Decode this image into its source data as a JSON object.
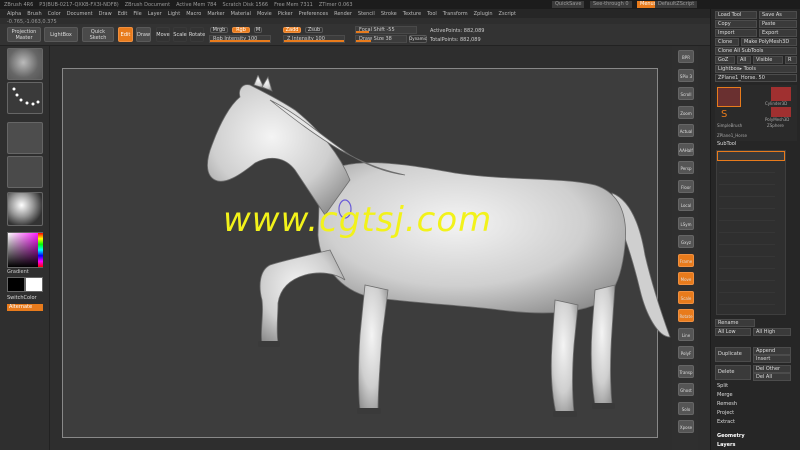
{
  "titlebar": {
    "items": [
      "ZBrush 4R6",
      "P3(BUB-0217-QXKB-FX3I-NDF8)",
      "ZBrush Document",
      "Active Mem 784",
      "Scratch Disk 1566",
      "Free Mem 7311",
      "ZTimer 0.063"
    ],
    "quicksave": "QuickSave",
    "seethrough": "See-through 0",
    "menus": "Menus",
    "script": "DefaultZScript"
  },
  "menubar": [
    "Alpha",
    "Brush",
    "Color",
    "Document",
    "Draw",
    "Edit",
    "File",
    "Layer",
    "Light",
    "Macro",
    "Marker",
    "Material",
    "Movie",
    "Picker",
    "Preferences",
    "Render",
    "Stencil",
    "Stroke",
    "Texture",
    "Tool",
    "Transform",
    "Zplugin",
    "Zscript"
  ],
  "coord": "-0.765,-1.063,0.375",
  "topshelf": {
    "projection_master": "Projection Master",
    "lightbox": "LightBox",
    "quick_sketch": "Quick Sketch",
    "edit": "Edit",
    "draw": "Draw",
    "move": "Move",
    "scale": "Scale",
    "rotate": "Rotate",
    "mrgb": "Mrgb",
    "rgb": "Rgb",
    "m": "M",
    "rgb_intensity": "Rgb Intensity 100",
    "zadd": "Zadd",
    "zsub": "Zsub",
    "z_intensity": "Z Intensity 100",
    "focal_shift": "Focal Shift -55",
    "draw_size": "Draw Size 38",
    "dynamic": "Dynamic",
    "active_points": "ActivePoints: 882,089",
    "total_points": "TotalPoints: 882,089"
  },
  "leftshelf": {
    "gradient": "Gradient",
    "switchcolor": "SwitchColor",
    "alternate": "Alternate"
  },
  "rightshelf": [
    "BPR",
    "SPix 3",
    "Scroll",
    "Zoom",
    "Actual",
    "AAHalf",
    "Persp",
    "Floor",
    "Local",
    "LSym",
    "Gxyz",
    "Frame",
    "Move",
    "Scale",
    "Rotate",
    "Line Fill",
    "PolyF",
    "Transp",
    "Ghost",
    "Solo",
    "Xpose"
  ],
  "tray": {
    "load_tool": "Load Tool",
    "save_as": "Save As",
    "copy": "Copy",
    "paste": "Paste",
    "import": "Import",
    "export": "Export",
    "clone": "Clone",
    "make_polymesh": "Make PolyMesh3D",
    "clone_all": "Clone All SubTools",
    "goz": "GoZ",
    "all": "All",
    "visible": "Visible",
    "r": "R",
    "lightbox_tools": "Lightbox▸ Tools",
    "current_tool": "ZPlane1_Horse. 50",
    "thumb_cylinder": "Cylinder3D",
    "thumb_polymesh": "PolyMesh3D",
    "thumb_zsphere": "ZSphere",
    "thumb_horse": "ZPlane1_Horse",
    "thumb_simplebrush": "SimpleBrush",
    "subtool": "SubTool",
    "rename": "Rename",
    "all_low": "All Low",
    "all_high": "All High",
    "duplicate": "Duplicate",
    "append": "Append",
    "insert": "Insert",
    "delete": "Delete",
    "del_other": "Del Other",
    "del_all": "Del All",
    "split": "Split",
    "merge": "Merge",
    "remesh": "Remesh",
    "project": "Project",
    "extract": "Extract",
    "geometry": "Geometry",
    "layers": "Layers"
  },
  "watermark": "www.cgtsj.com",
  "colors": {
    "accent": "#e87b1c",
    "watermark": "#f2f21a",
    "canvas": "#3d3d3d"
  }
}
